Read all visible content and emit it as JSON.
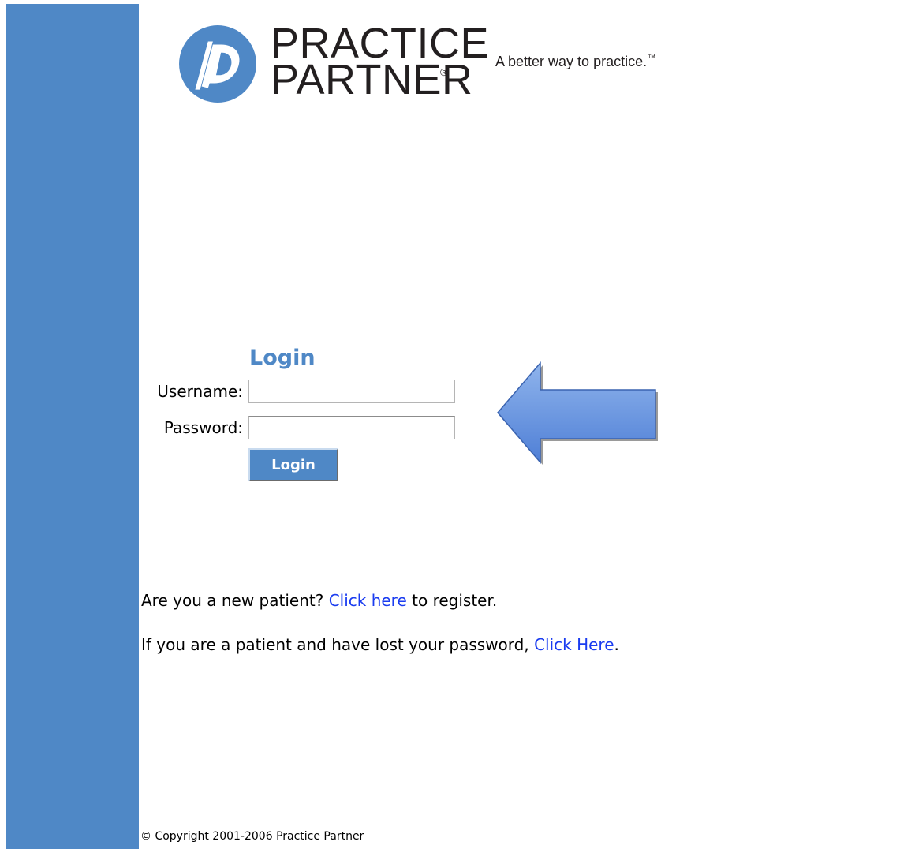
{
  "brand": {
    "name_line1": "PRACTICE",
    "name_line2": "PARTNER",
    "registered_mark": "®",
    "tagline": "A better way to practice.",
    "trademark": "™",
    "logo_icon": "practice-partner-logo",
    "accent_color": "#4f88c6"
  },
  "login": {
    "heading": "Login",
    "username_label": "Username:",
    "username_value": "",
    "password_label": "Password:",
    "password_value": "",
    "submit_label": "Login"
  },
  "annotation": {
    "icon": "left-arrow-icon",
    "color": "#6a9be0"
  },
  "links": {
    "register_prefix": "Are you a new patient? ",
    "register_link": "Click here",
    "register_suffix": " to register.",
    "lost_prefix": "If you are a patient and have lost your password, ",
    "lost_link": "Click Here",
    "lost_suffix": ".",
    "link_color": "#1a3cf0"
  },
  "footer": {
    "copyright": "© Copyright 2001-2006 Practice Partner"
  }
}
